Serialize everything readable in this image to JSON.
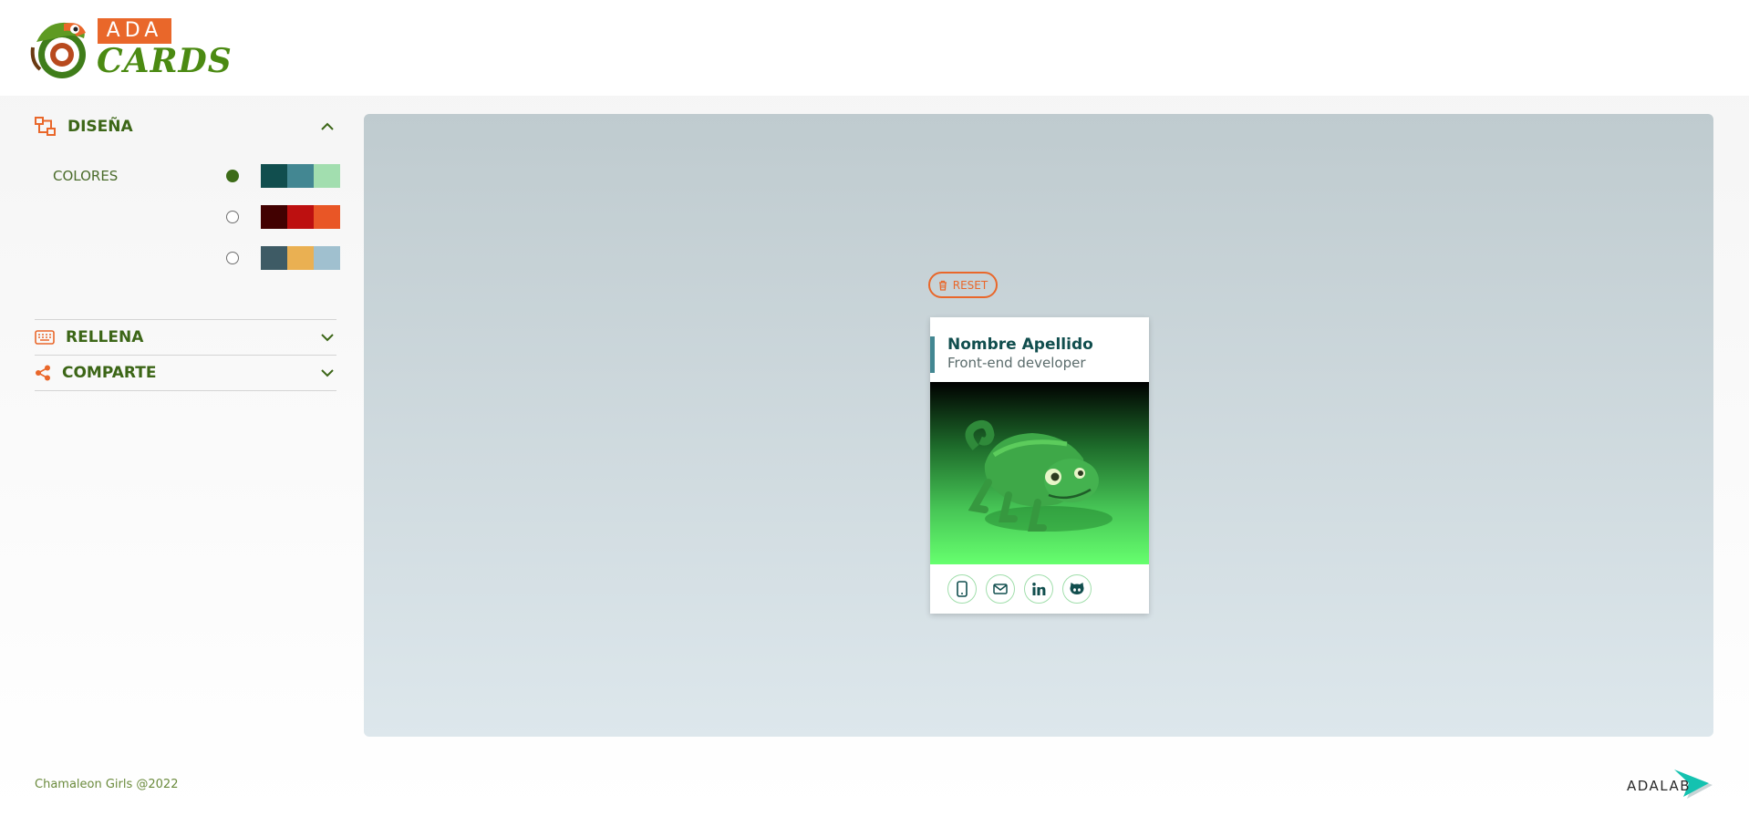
{
  "logo": {
    "top_text": "ADA",
    "bottom_text": "CARDS"
  },
  "sidebar": {
    "design": {
      "title": "DISEÑA",
      "colors_label": "COLORES"
    },
    "palettes": [
      {
        "checked": true,
        "colors": [
          "#114e4e",
          "#438792",
          "#a2deaf"
        ]
      },
      {
        "checked": false,
        "colors": [
          "#420101",
          "#bd1010",
          "#e95626"
        ]
      },
      {
        "checked": false,
        "colors": [
          "#3e5b65",
          "#eab052",
          "#a0c0cf"
        ]
      }
    ],
    "fill": {
      "title": "RELLENA"
    },
    "share": {
      "title": "COMPARTE"
    }
  },
  "preview": {
    "reset_label": "RESET",
    "card": {
      "name": "Nombre Apellido",
      "job": "Front-end developer",
      "social": [
        "phone-icon",
        "mail-icon",
        "linkedin-icon",
        "github-icon"
      ]
    }
  },
  "footer": {
    "credit": "Chamaleon Girls @2022",
    "brand": "ADALAB"
  },
  "colors": {
    "accent": "#e9672a",
    "primary": "#3c6617",
    "card_dark": "#114e4e"
  }
}
